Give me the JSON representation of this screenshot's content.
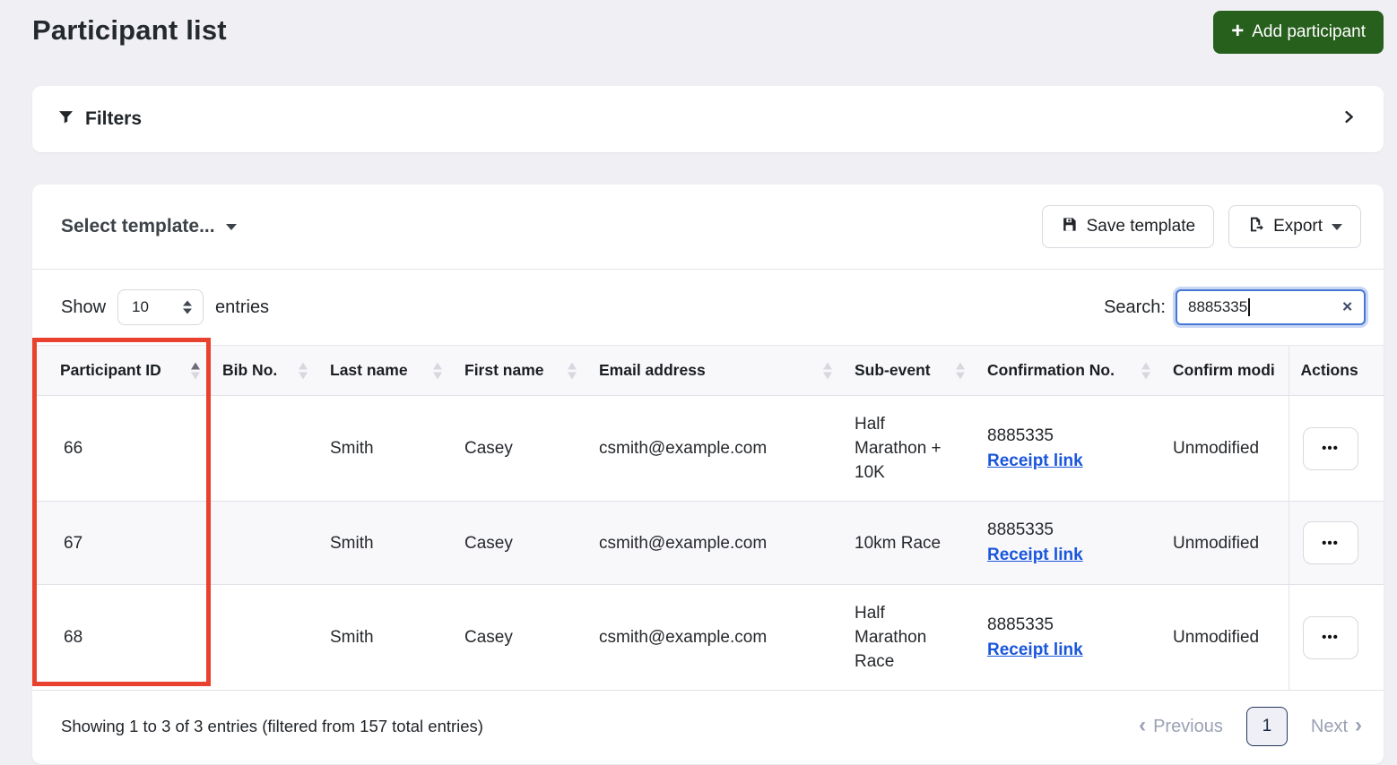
{
  "page": {
    "title": "Participant list"
  },
  "header": {
    "add_participant_label": "Add participant",
    "add_plus_glyph": "+"
  },
  "filters": {
    "label": "Filters"
  },
  "toolbar": {
    "select_template_label": "Select template...",
    "save_template_label": "Save template",
    "export_label": "Export"
  },
  "controls": {
    "show_label": "Show",
    "entries_label": "entries",
    "page_size_value": "10",
    "search_label": "Search:",
    "search_value": "8885335",
    "clear_glyph": "✕"
  },
  "table": {
    "actions_icon": "•••",
    "columns": [
      {
        "label": "Participant ID",
        "sortable": true,
        "sort": "asc"
      },
      {
        "label": "Bib No.",
        "sortable": true,
        "sort": "none"
      },
      {
        "label": "Last name",
        "sortable": true,
        "sort": "none"
      },
      {
        "label": "First name",
        "sortable": true,
        "sort": "none"
      },
      {
        "label": "Email address",
        "sortable": true,
        "sort": "none"
      },
      {
        "label": "Sub-event",
        "sortable": true,
        "sort": "none"
      },
      {
        "label": "Confirmation No.",
        "sortable": true,
        "sort": "none"
      },
      {
        "label": "Confirm modi",
        "sortable": false,
        "sort": "none",
        "note_visible_truncated": "Confirm modi"
      },
      {
        "label": "Actions",
        "sortable": false,
        "sort": "none"
      }
    ],
    "rows": [
      {
        "participant_id": "66",
        "bib_no": "",
        "last_name": "Smith",
        "first_name": "Casey",
        "email": "csmith@example.com",
        "sub_event": "Half Marathon + 10K",
        "confirmation_no": "8885335",
        "receipt_link_label": "Receipt link",
        "confirm_modified": "Unmodified"
      },
      {
        "participant_id": "67",
        "bib_no": "",
        "last_name": "Smith",
        "first_name": "Casey",
        "email": "csmith@example.com",
        "sub_event": "10km Race",
        "confirmation_no": "8885335",
        "receipt_link_label": "Receipt link",
        "confirm_modified": "Unmodified"
      },
      {
        "participant_id": "68",
        "bib_no": "",
        "last_name": "Smith",
        "first_name": "Casey",
        "email": "csmith@example.com",
        "sub_event": "Half Marathon Race",
        "confirmation_no": "8885335",
        "receipt_link_label": "Receipt link",
        "confirm_modified": "Unmodified"
      }
    ]
  },
  "footer": {
    "summary": "Showing 1 to 3 of 3 entries (filtered from 157 total entries)",
    "pagination": {
      "previous_label": "Previous",
      "previous_chevron": "‹",
      "current_page": "1",
      "next_label": "Next",
      "next_chevron": "›"
    }
  },
  "colors": {
    "accent_green": "#275f1d",
    "link_blue": "#1a56db",
    "search_focus_blue": "#4577d4",
    "annotation_red": "#e8422e",
    "page_background": "#f0f0f4"
  }
}
